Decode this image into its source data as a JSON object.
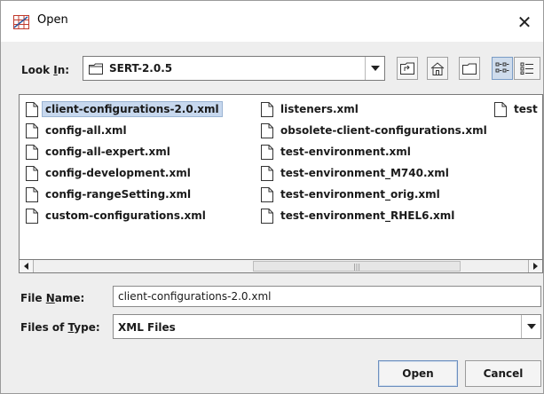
{
  "window": {
    "title": "Open",
    "close_glyph": "✕"
  },
  "look_in": {
    "label_prefix": "Look ",
    "label_mnemonic": "I",
    "label_suffix": "n:",
    "value": "SERT-2.0.5"
  },
  "toolbar": {
    "buttons": [
      "up-folder-icon",
      "home-icon",
      "new-folder-icon",
      "list-view-icon",
      "details-view-icon"
    ],
    "active": "list-view-icon"
  },
  "files": {
    "column1": [
      "client-configurations-2.0.xml",
      "config-all.xml",
      "config-all-expert.xml",
      "config-development.xml",
      "config-rangeSetting.xml",
      "custom-configurations.xml"
    ],
    "column2": [
      "listeners.xml",
      "obsolete-client-configurations.xml",
      "test-environment.xml",
      "test-environment_M740.xml",
      "test-environment_orig.xml",
      "test-environment_RHEL6.xml"
    ],
    "column3": [
      "test"
    ],
    "selected": "client-configurations-2.0.xml"
  },
  "scrollbar": {
    "thumb_glyph": "|||"
  },
  "file_name": {
    "label_prefix": "File ",
    "label_mnemonic": "N",
    "label_suffix": "ame:",
    "value": "client-configurations-2.0.xml"
  },
  "file_type": {
    "label_prefix": "Files of ",
    "label_mnemonic": "T",
    "label_suffix": "ype:",
    "value": "XML Files"
  },
  "buttons": {
    "open": "Open",
    "cancel": "Cancel"
  },
  "colors": {
    "selection": "#c7d8ee",
    "dialog_bg": "#eeeeee"
  }
}
